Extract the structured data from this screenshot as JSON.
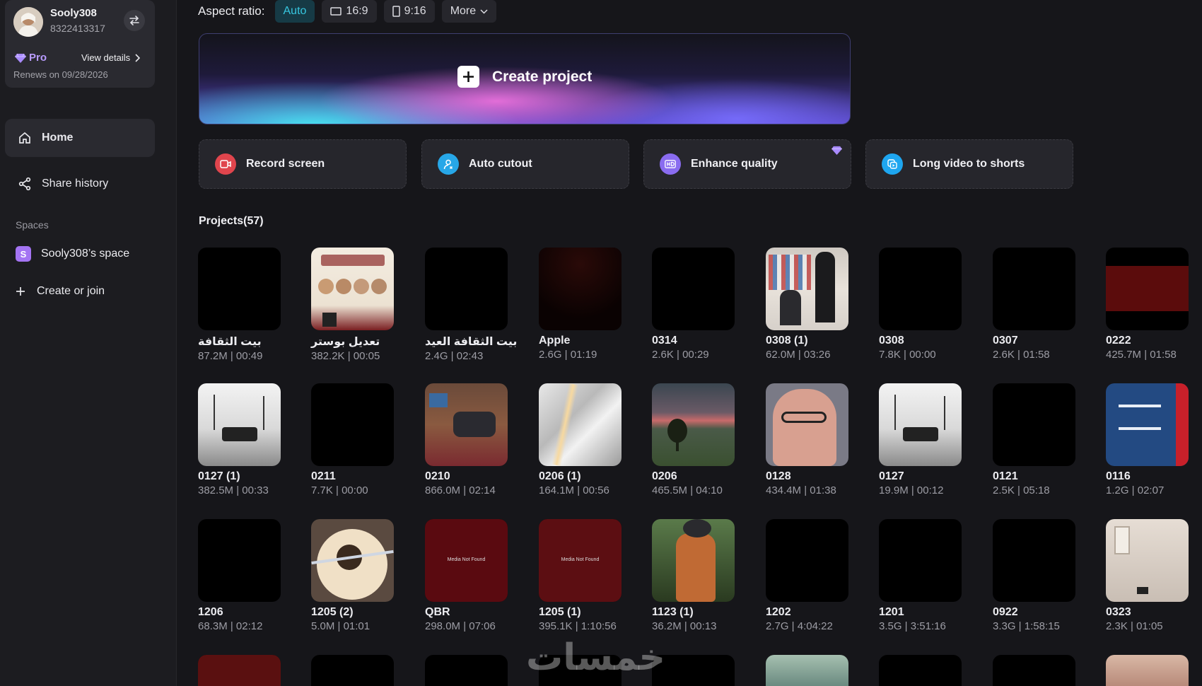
{
  "profile": {
    "username": "Sooly308",
    "phone": "8322413317",
    "plan": "Pro",
    "view_details": "View details",
    "renews": "Renews on 09/28/2026"
  },
  "nav": {
    "home": "Home",
    "share_history": "Share history",
    "spaces_label": "Spaces",
    "space_badge": "S",
    "space_name": "Sooly308’s space",
    "create_or_join": "Create or join"
  },
  "aspect": {
    "label": "Aspect ratio:",
    "options": [
      "Auto",
      "16:9",
      "9:16",
      "More"
    ],
    "selected": "Auto"
  },
  "create": {
    "label": "Create project"
  },
  "tools": [
    {
      "label": "Record screen",
      "icon": "record-icon",
      "color": "#e0454d"
    },
    {
      "label": "Auto cutout",
      "icon": "person-cutout-icon",
      "color": "#27a7e8"
    },
    {
      "label": "Enhance quality",
      "icon": "hd-icon",
      "color": "#8a6cf0"
    },
    {
      "label": "Long video to shorts",
      "icon": "shorts-icon",
      "color": "#1ea6f0"
    }
  ],
  "projects_title": "Projects(57)",
  "projects": [
    {
      "name": "بيت الثقافة",
      "meta": "87.2M | 00:49",
      "thumb": "black"
    },
    {
      "name": "تعديل بوستر",
      "meta": "382.2K | 00:05",
      "thumb": "poster"
    },
    {
      "name": "بيت الثقافة العيد",
      "meta": "2.4G | 02:43",
      "thumb": "black"
    },
    {
      "name": "Apple",
      "meta": "2.6G | 01:19",
      "thumb": "darkred"
    },
    {
      "name": "0314",
      "meta": "2.6K | 00:29",
      "thumb": "black"
    },
    {
      "name": "0308 (1)",
      "meta": "62.0M | 03:26",
      "thumb": "library"
    },
    {
      "name": "0308",
      "meta": "7.8K | 00:00",
      "thumb": "black"
    },
    {
      "name": "0307",
      "meta": "2.6K | 01:58",
      "thumb": "black"
    },
    {
      "name": "0222",
      "meta": "425.7M | 01:58",
      "thumb": "redband"
    },
    {
      "name": "0127 (1)",
      "meta": "382.5M | 00:33",
      "thumb": "fountain"
    },
    {
      "name": "0211",
      "meta": "7.7K | 00:00",
      "thumb": "black"
    },
    {
      "name": "0210",
      "meta": "866.0M | 02:14",
      "thumb": "room"
    },
    {
      "name": "0206 (1)",
      "meta": "164.1M | 00:56",
      "thumb": "silk"
    },
    {
      "name": "0206",
      "meta": "465.5M | 04:10",
      "thumb": "tree"
    },
    {
      "name": "0128",
      "meta": "434.4M | 01:38",
      "thumb": "face"
    },
    {
      "name": "0127",
      "meta": "19.9M | 00:12",
      "thumb": "fountain"
    },
    {
      "name": "0121",
      "meta": "2.5K | 05:18",
      "thumb": "black"
    },
    {
      "name": "0116",
      "meta": "1.2G | 02:07",
      "thumb": "sign"
    },
    {
      "name": "1206",
      "meta": "68.3M | 02:12",
      "thumb": "black"
    },
    {
      "name": "1205 (2)",
      "meta": "5.0M | 01:01",
      "thumb": "oud"
    },
    {
      "name": "QBR",
      "meta": "298.0M | 07:06",
      "thumb": "mnf"
    },
    {
      "name": "1205 (1)",
      "meta": "395.1K | 1:10:56",
      "thumb": "mnf2"
    },
    {
      "name": "1123 (1)",
      "meta": "36.2M | 00:13",
      "thumb": "backpack"
    },
    {
      "name": "1202",
      "meta": "2.7G | 4:04:22",
      "thumb": "black"
    },
    {
      "name": "1201",
      "meta": "3.5G | 3:51:16",
      "thumb": "black"
    },
    {
      "name": "0922",
      "meta": "3.3G | 1:58:15",
      "thumb": "black"
    },
    {
      "name": "0323",
      "meta": "2.3K | 01:05",
      "thumb": "wall"
    }
  ],
  "partial_row_thumbs": [
    "darkred2",
    "black",
    "black",
    "black",
    "black",
    "teal",
    "black",
    "black",
    "sand"
  ],
  "media_not_found": "Media Not Found",
  "watermark": "خمسات"
}
